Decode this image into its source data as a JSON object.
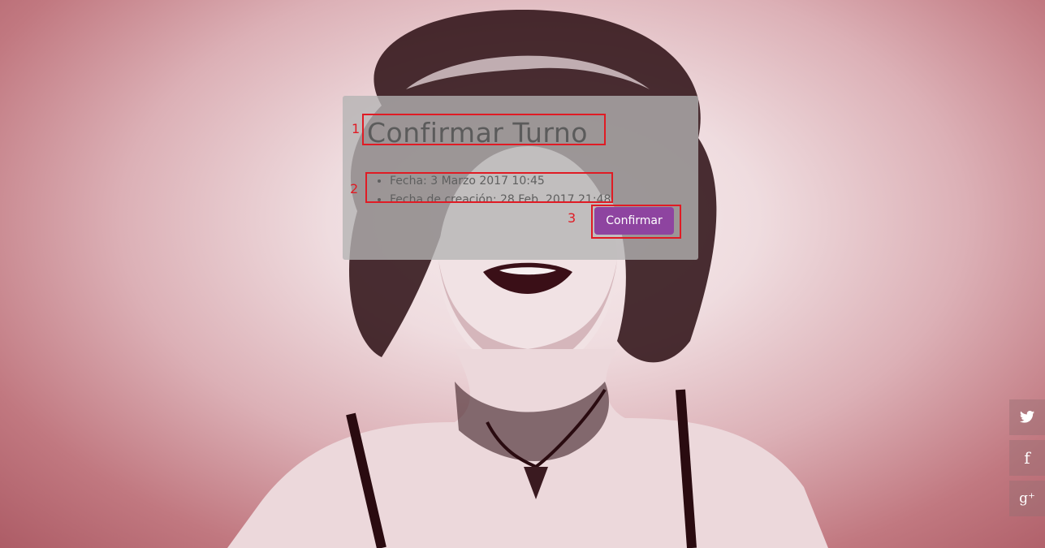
{
  "page": {
    "title": "Confirmar Turno",
    "details": [
      "Fecha: 3 Marzo 2017 10:45",
      "Fecha de creación: 28 Feb. 2017 21:48"
    ],
    "confirm_label": "Confirmar"
  },
  "annotations": [
    "1",
    "2",
    "3"
  ],
  "social": {
    "twitter_icon": "twitter-icon",
    "facebook_icon": "facebook-icon",
    "facebook_glyph": "f",
    "googleplus_icon": "google-plus-icon",
    "googleplus_glyph": "g⁺"
  },
  "colors": {
    "accent": "#8e44a0",
    "annotation": "#e01b24"
  }
}
